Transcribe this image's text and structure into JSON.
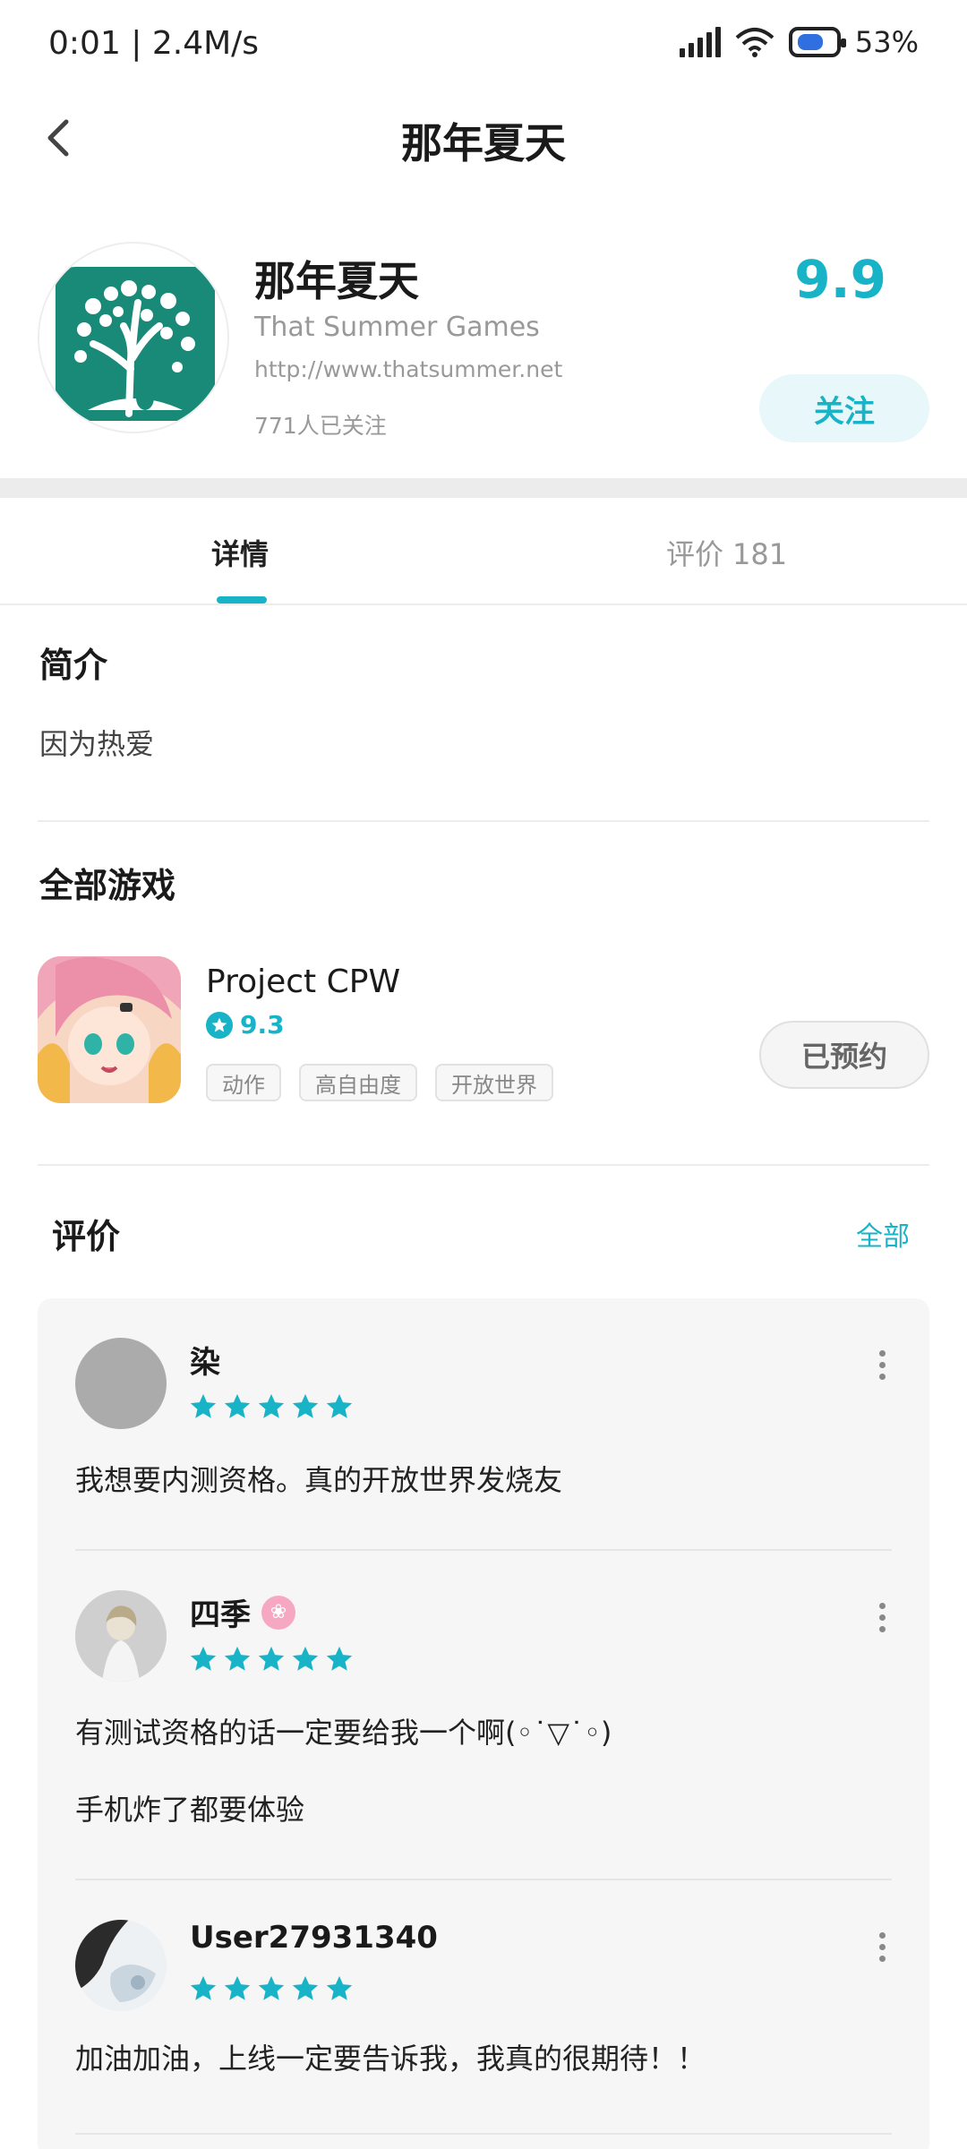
{
  "status_bar": {
    "time": "0:01 | 2.4M/s",
    "battery": "53%"
  },
  "nav": {
    "title": "那年夏天"
  },
  "profile": {
    "name": "那年夏天",
    "subtitle": "That Summer Games",
    "url": "http://www.thatsummer.net",
    "followers": "771人已关注",
    "score": "9.9",
    "follow_label": "关注"
  },
  "tabs": [
    {
      "label": "详情"
    },
    {
      "label": "评价",
      "count": "181"
    }
  ],
  "intro": {
    "title": "简介",
    "text": "因为热爱"
  },
  "games": {
    "title": "全部游戏",
    "items": [
      {
        "name": "Project CPW",
        "rating": "9.3",
        "tags": [
          "动作",
          "高自由度",
          "开放世界"
        ],
        "button": "已预约"
      }
    ]
  },
  "reviews": {
    "title": "评价",
    "all_label": "全部",
    "items": [
      {
        "user": "染",
        "stars": 5,
        "lines": [
          "我想要内测资格。真的开放世界发烧友"
        ]
      },
      {
        "user": "四季",
        "stars": 5,
        "lines": [
          "有测试资格的话一定要给我一个啊(◦˙▽˙◦)",
          "手机炸了都要体验"
        ]
      },
      {
        "user": "User27931340",
        "stars": 5,
        "lines": [
          "加油加油，上线一定要告诉我，我真的很期待！！"
        ]
      }
    ]
  },
  "colors": {
    "accent": "#18b3c7",
    "logo_green": "#1a8a78"
  }
}
